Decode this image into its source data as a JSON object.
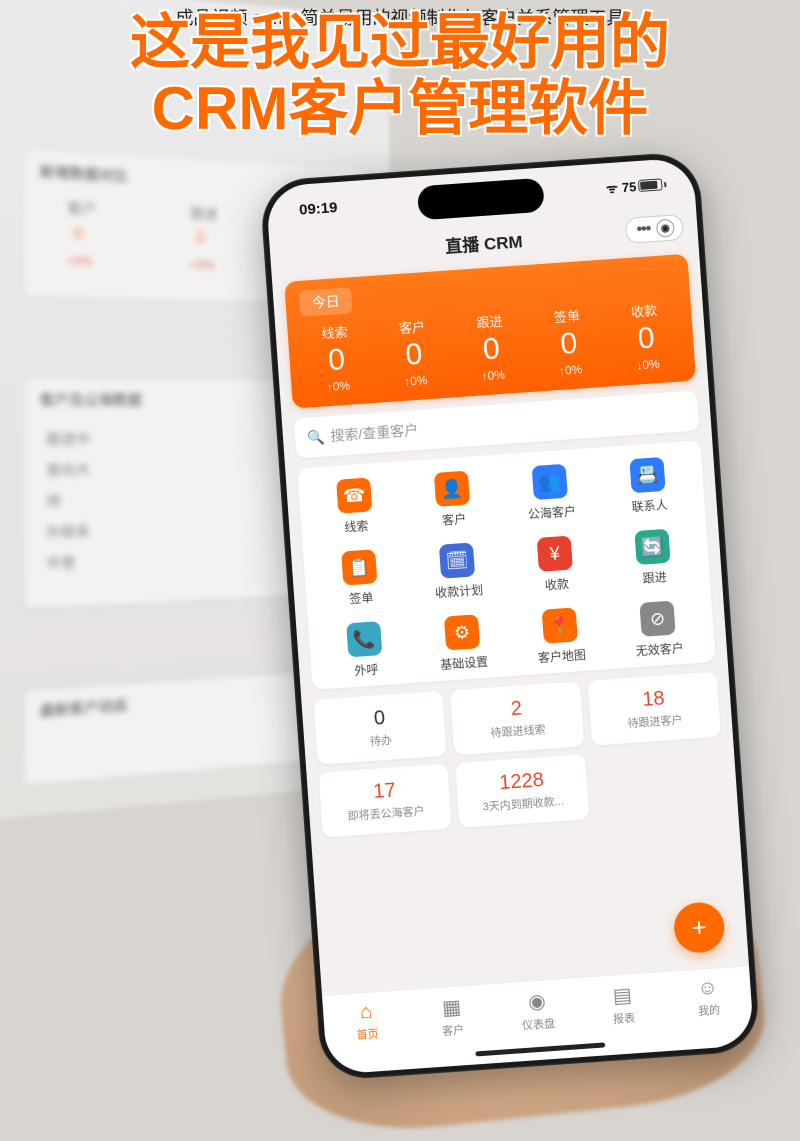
{
  "caption": "成品视频 crm：简单易用的视频制作与客户关系管理工具",
  "headline_l1": "这是我见过最好用的",
  "headline_l2": "CRM客户管理软件",
  "bg": {
    "panel1_title": "新增数据对比",
    "col1": "客户",
    "col2": "跟进",
    "num": "0",
    "pct": "+0%",
    "panel2_title": "客户及公海数据",
    "rows": [
      "跟进中",
      "意向大",
      "待",
      "外联系",
      "中意"
    ],
    "panel3_title": "最新客户动态"
  },
  "status": {
    "time": "09:19",
    "battery": "75"
  },
  "app_title": "直播 CRM",
  "today_label": "今日",
  "metrics": [
    {
      "label": "线索",
      "value": "0",
      "delta": "↑0%"
    },
    {
      "label": "客户",
      "value": "0",
      "delta": "↑0%"
    },
    {
      "label": "跟进",
      "value": "0",
      "delta": "↑0%"
    },
    {
      "label": "签单",
      "value": "0",
      "delta": "↑0%"
    },
    {
      "label": "收款",
      "value": "0",
      "delta": "↓0%"
    }
  ],
  "search_placeholder": "搜索/查重客户",
  "grid": [
    {
      "label": "线索",
      "bg": "#ff6a00",
      "glyph": "☎"
    },
    {
      "label": "客户",
      "bg": "#ff6a00",
      "glyph": "👤"
    },
    {
      "label": "公海客户",
      "bg": "#2f7bff",
      "glyph": "👥"
    },
    {
      "label": "联系人",
      "bg": "#2f7bff",
      "glyph": "📇"
    },
    {
      "label": "签单",
      "bg": "#ff6a00",
      "glyph": "📋"
    },
    {
      "label": "收款计划",
      "bg": "#416bd6",
      "glyph": "🗓"
    },
    {
      "label": "收款",
      "bg": "#e6402e",
      "glyph": "¥"
    },
    {
      "label": "跟进",
      "bg": "#2aa88a",
      "glyph": "🔄"
    },
    {
      "label": "外呼",
      "bg": "#3aa6c4",
      "glyph": "📞"
    },
    {
      "label": "基础设置",
      "bg": "#ff6a00",
      "glyph": "⚙"
    },
    {
      "label": "客户地图",
      "bg": "#ff6a00",
      "glyph": "📍"
    },
    {
      "label": "无效客户",
      "bg": "#888",
      "glyph": "⊘"
    }
  ],
  "stats": [
    {
      "num": "0",
      "label": "待办",
      "cls": "s-dark"
    },
    {
      "num": "2",
      "label": "待跟进线索",
      "cls": "s-red"
    },
    {
      "num": "18",
      "label": "待跟进客户",
      "cls": "s-red"
    },
    {
      "num": "17",
      "label": "即将丢公海客户",
      "cls": "s-red"
    },
    {
      "num": "1228",
      "label": "3天内到期收款...",
      "cls": "s-red"
    }
  ],
  "fab": "+",
  "tabs": [
    {
      "label": "首页",
      "glyph": "⌂",
      "active": true
    },
    {
      "label": "客户",
      "glyph": "▦",
      "active": false
    },
    {
      "label": "仪表盘",
      "glyph": "◉",
      "active": false
    },
    {
      "label": "报表",
      "glyph": "▤",
      "active": false
    },
    {
      "label": "我的",
      "glyph": "☺",
      "active": false
    }
  ]
}
